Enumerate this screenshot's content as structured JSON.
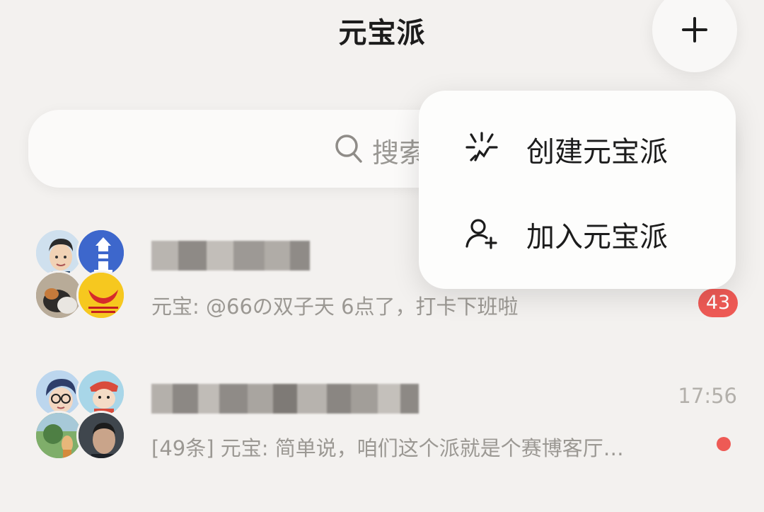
{
  "header": {
    "title": "元宝派",
    "add_icon": "plus-icon"
  },
  "search": {
    "icon": "search-icon",
    "placeholder_visible": "搜索"
  },
  "popup_menu": {
    "items": [
      {
        "label": "创建元宝派",
        "icon": "sparkle-create-icon"
      },
      {
        "label": "加入元宝派",
        "icon": "add-person-icon"
      }
    ]
  },
  "chats": [
    {
      "name_obscured": true,
      "preview": "元宝: @66の双子天 6点了，打卡下班啦",
      "time": "",
      "unread_count": "43",
      "avatars": [
        "cartoon-man-avatar",
        "lighthouse-avatar",
        "cat-avatar",
        "happiness-logo-avatar"
      ]
    },
    {
      "name_obscured": true,
      "preview": "[49条] 元宝: 简单说，咱们这个派就是个赛博客厅…",
      "time": "17:56",
      "unread_count": "",
      "unread_dot": true,
      "avatars": [
        "glasses-boy-avatar",
        "cartoon-kid-avatar",
        "forest-avatar",
        "photo-man-avatar"
      ]
    }
  ],
  "colors": {
    "background": "#f3f1ef",
    "badge_red": "#ee5a55",
    "muted_text": "#9b9893"
  }
}
